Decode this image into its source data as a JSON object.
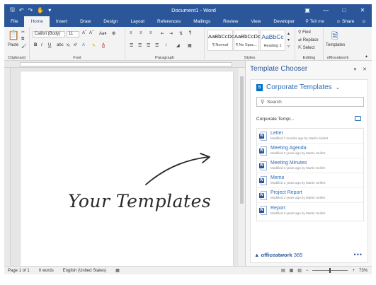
{
  "window": {
    "title": "Document1 - Word"
  },
  "qat": {
    "save_icon": "save-icon",
    "undo_icon": "undo-icon",
    "redo_icon": "redo-icon",
    "touch_icon": "touch-mode-icon"
  },
  "tabs": [
    "File",
    "Home",
    "Insert",
    "Draw",
    "Design",
    "Layout",
    "References",
    "Mailings",
    "Review",
    "View",
    "Developer"
  ],
  "active_tab": "Home",
  "tell_me": "Tell me",
  "share": "Share",
  "ribbon": {
    "paste_label": "Paste",
    "clipboard_label": "Clipboard",
    "font_name": "Calibri (Body)",
    "font_size": "11",
    "font_label": "Font",
    "paragraph_label": "Paragraph",
    "styles": [
      {
        "sample": "AaBbCcDc",
        "name": "¶ Normal"
      },
      {
        "sample": "AaBbCcDc",
        "name": "¶ No Spac..."
      },
      {
        "sample": "AaBbCc",
        "name": "Heading 1"
      }
    ],
    "styles_label": "Styles",
    "find_label": "Find",
    "replace_label": "Replace",
    "select_label": "Select",
    "editing_label": "Editing",
    "templates_label": "Templates",
    "officeatwork_label": "officeatwork"
  },
  "document": {
    "handwritten_text": "Your Templates"
  },
  "task_pane": {
    "title": "Template Chooser",
    "library_title": "Corporate Templates",
    "search_placeholder": "Search",
    "breadcrumb": "Corporate Templ...",
    "templates": [
      {
        "name": "Letter",
        "meta": "Modified 7 months ago by Martin Seifert"
      },
      {
        "name": "Meeting Agenda",
        "meta": "Modified 2 years ago by Martin Seifert"
      },
      {
        "name": "Meeting Minutes",
        "meta": "Modified 2 years ago by Martin Seifert"
      },
      {
        "name": "Memo",
        "meta": "Modified 2 years ago by Martin Seifert"
      },
      {
        "name": "Project Report",
        "meta": "Modified 2 years ago by Martin Seifert"
      },
      {
        "name": "Report",
        "meta": "Modified 2 years ago by Martin Seifert"
      }
    ],
    "footer_brand": "officeatwork",
    "footer_suffix": "365"
  },
  "status": {
    "page": "Page 1 of 1",
    "words": "0 words",
    "language": "English (United States)",
    "zoom": "73%"
  },
  "colors": {
    "accent": "#2b579a",
    "link": "#2b6cb5"
  }
}
